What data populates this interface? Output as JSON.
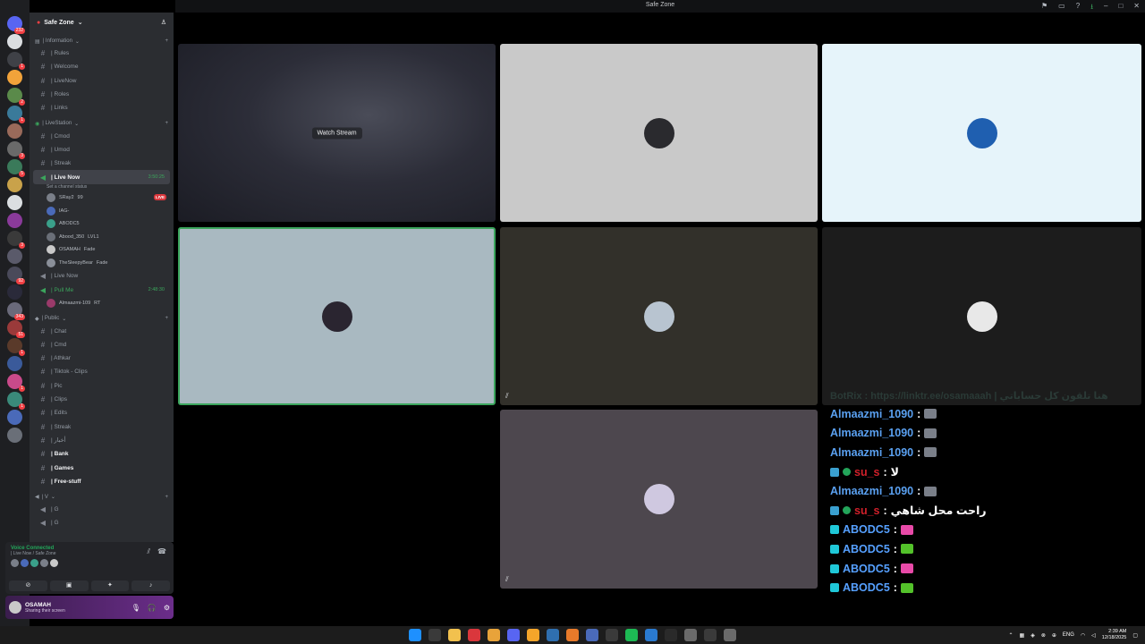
{
  "window": {
    "title": "Safe Zone"
  },
  "rail": {
    "servers": [
      {
        "color": "#5865f2",
        "badge": "232"
      },
      {
        "color": "#dbdee1",
        "badge": ""
      },
      {
        "color": "#3f4147",
        "badge": "1"
      },
      {
        "color": "#f2a33a",
        "badge": ""
      },
      {
        "color": "#5a8a4a",
        "badge": "2"
      },
      {
        "color": "#3a7a9a",
        "badge": "1"
      },
      {
        "color": "#9a6a5a",
        "badge": ""
      },
      {
        "color": "#6a6a6a",
        "badge": "3"
      },
      {
        "color": "#3a7a5a",
        "badge": "5"
      },
      {
        "color": "#c9a24a",
        "badge": ""
      },
      {
        "color": "#dbdee1",
        "badge": ""
      },
      {
        "color": "#8a3a9a",
        "badge": ""
      },
      {
        "color": "#3a3a3a",
        "badge": "3"
      },
      {
        "color": "#5a5a6a",
        "badge": ""
      },
      {
        "color": "#4a4a5a",
        "badge": "92"
      },
      {
        "color": "#2a2a3a",
        "badge": ""
      },
      {
        "color": "#6a6a7a",
        "badge": "343"
      },
      {
        "color": "#9a3a3a",
        "badge": "51"
      },
      {
        "color": "#5a3a2a",
        "badge": "1"
      },
      {
        "color": "#3a5a9a",
        "badge": ""
      },
      {
        "color": "#c94a8a",
        "badge": "1"
      },
      {
        "color": "#3a8a7a",
        "badge": "1"
      },
      {
        "color": "#4a6ab9",
        "badge": ""
      },
      {
        "color": "#6a6f78",
        "badge": ""
      }
    ]
  },
  "sidebar": {
    "guild_name": "Safe Zone",
    "categories": {
      "information": "| Information",
      "livestation": "| LiveStation",
      "public": "| Public",
      "v": "| V"
    },
    "info_channels": [
      "| Rules",
      "| Welcome",
      "| LiveNow",
      "| Roles",
      "| Links"
    ],
    "live_channels": [
      "| Cmod",
      "| Umod",
      "| Streak"
    ],
    "live_now": {
      "name": "| Live Now",
      "time": "3:50:25",
      "status": "Set a channel status"
    },
    "live_users": [
      {
        "name": "SRay2",
        "extra": "99",
        "live": "LIVE",
        "color": "#7a7f89"
      },
      {
        "name": "IAG-",
        "extra": "",
        "live": "",
        "color": "#4a6ab9"
      },
      {
        "name": "ABODC5",
        "extra": "",
        "live": "",
        "color": "#3aa08a"
      },
      {
        "name": "Abood_350",
        "extra": "LVL1",
        "live": "",
        "color": "#6a6f78"
      },
      {
        "name": "OSAMAH",
        "extra": "Fade",
        "live": "",
        "color": "#c9c9c9"
      },
      {
        "name": "TheSleepyBear",
        "extra": "Fade",
        "live": "",
        "color": "#8a8f99"
      }
    ],
    "live_now_2": "| Live Now",
    "pull_me": {
      "name": "| Pull Me",
      "time": "2:48:30"
    },
    "pull_users": [
      {
        "name": "Almaazmi-109",
        "extra": "RT",
        "color": "#9a3a6a"
      }
    ],
    "public_channels": [
      "| Chat",
      "| Cmd",
      "| Athkar",
      "| Tiktok - Clips",
      "| Pic",
      "| Clips",
      "| Edits",
      "| Streak",
      "| أخبار"
    ],
    "bank": "| Bank",
    "games": "| Games",
    "free_stuff": "| Free-stuff",
    "v_channels": [
      "| G",
      "| G"
    ]
  },
  "voice_panel": {
    "title": "Voice Connected",
    "sub": "| Live Now / Safe Zone"
  },
  "user_panel": {
    "name": "OSAMAH",
    "status": "Sharing their screen"
  },
  "stage": {
    "watch_label": "Watch Stream",
    "tiles": [
      {
        "bg": "#c9c9c9",
        "av": "#2a2a2e"
      },
      {
        "bg": "#e6f4fa",
        "av": "#1f5fb0"
      },
      {
        "bg": "#a9b9c1",
        "av": "#2a2530"
      },
      {
        "bg": "#32302a",
        "av": "#b8c4d0"
      },
      {
        "bg": "#1c1c1c",
        "av": "#e8e8e8"
      },
      {
        "bg": "#4d474e",
        "av": "#cfc8e0"
      }
    ]
  },
  "chat": {
    "header": "BotRix : https://linktr.ee/osamaaah | هنا تلقون كل حساباتي",
    "messages": [
      {
        "user": "Almaazmi_1090",
        "style": "blue",
        "text": "",
        "emote": "#7a7f89"
      },
      {
        "user": "Almaazmi_1090",
        "style": "blue",
        "text": "",
        "emote": "#7a7f89"
      },
      {
        "user": "Almaazmi_1090",
        "style": "blue",
        "text": "",
        "emote": "#7a7f89"
      },
      {
        "user": "su_s",
        "style": "red",
        "text": "لا",
        "emote": ""
      },
      {
        "user": "Almaazmi_1090",
        "style": "blue",
        "text": "",
        "emote": "#7a7f89"
      },
      {
        "user": "su_s",
        "style": "red",
        "text": "راحت محل شاهي",
        "emote": ""
      },
      {
        "user": "ABODC5",
        "style": "cyan",
        "text": "",
        "emote": "#e84aa8"
      },
      {
        "user": "ABODC5",
        "style": "cyan",
        "text": "",
        "emote": "#53c22a"
      },
      {
        "user": "ABODC5",
        "style": "cyan",
        "text": "",
        "emote": "#e84aa8"
      },
      {
        "user": "ABODC5",
        "style": "cyan",
        "text": "",
        "emote": "#53c22a"
      }
    ]
  },
  "taskbar": {
    "apps": [
      "#1e90ff",
      "#3a3a3a",
      "#f2c14e",
      "#da373c",
      "#e8a33a",
      "#5865f2",
      "#f4a52a",
      "#2f6fb0",
      "#e87a2a",
      "#4a6ab9",
      "#3a3a3a",
      "#1db954",
      "#2a7ad0",
      "#2a2a2a",
      "#6a6a6a",
      "#3a3a3a",
      "#6a6a6a"
    ],
    "lang": "ENG",
    "time": "2:39 AM",
    "date": "12/18/2025"
  }
}
